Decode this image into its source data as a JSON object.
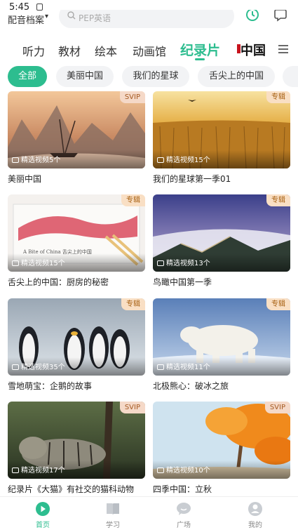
{
  "status_bar": {
    "time": "5:45"
  },
  "header": {
    "profile_name": "配音档案",
    "profile_caret": "▾",
    "search_placeholder": "PEP英语"
  },
  "category_tabs": [
    {
      "label": "听力",
      "active": false
    },
    {
      "label": "教材",
      "active": false
    },
    {
      "label": "绘本",
      "active": false
    },
    {
      "label": "动画馆",
      "active": false
    },
    {
      "label": "纪录片",
      "active": true
    }
  ],
  "china_logo_text": "中国",
  "filter_chips": [
    {
      "label": "全部",
      "active": true
    },
    {
      "label": "美丽中国",
      "active": false
    },
    {
      "label": "我们的星球",
      "active": false
    },
    {
      "label": "舌尖上的中国",
      "active": false
    }
  ],
  "cards": [
    {
      "title": "美丽中国",
      "badge": "SVIP",
      "count_text": "精选视频5个"
    },
    {
      "title": "我们的星球第一季01",
      "badge": "专辑",
      "count_text": "精选视频15个"
    },
    {
      "title": "舌尖上的中国：厨房的秘密",
      "badge": "专辑",
      "count_text": "精选视频15个",
      "thumb_caption": "A Bite of China  舌尖上的中国"
    },
    {
      "title": "鸟瞰中国第一季",
      "badge": "专辑",
      "count_text": "精选视频13个"
    },
    {
      "title": "雪地萌宝：企鹅的故事",
      "badge": "专辑",
      "count_text": "精选视频35个"
    },
    {
      "title": "北极熊心：破冰之旅",
      "badge": "专辑",
      "count_text": "精选视频11个"
    },
    {
      "title": "纪录片《大猫》有社交的猫科动物",
      "badge": "SVIP",
      "count_text": "精选视频17个"
    },
    {
      "title": "四季中国：立秋",
      "badge": "SVIP",
      "count_text": "精选视频10个"
    }
  ],
  "bottom_nav": [
    {
      "label": "首页",
      "icon": "home-play-icon",
      "active": true
    },
    {
      "label": "学习",
      "icon": "book-icon",
      "active": false
    },
    {
      "label": "广场",
      "icon": "chat-bubble-icon",
      "active": false
    },
    {
      "label": "我的",
      "icon": "profile-icon",
      "active": false
    }
  ],
  "colors": {
    "accent": "#2dbd8f",
    "chip_bg": "#f2f3f5",
    "badge_bg": "#f9dfc4"
  }
}
